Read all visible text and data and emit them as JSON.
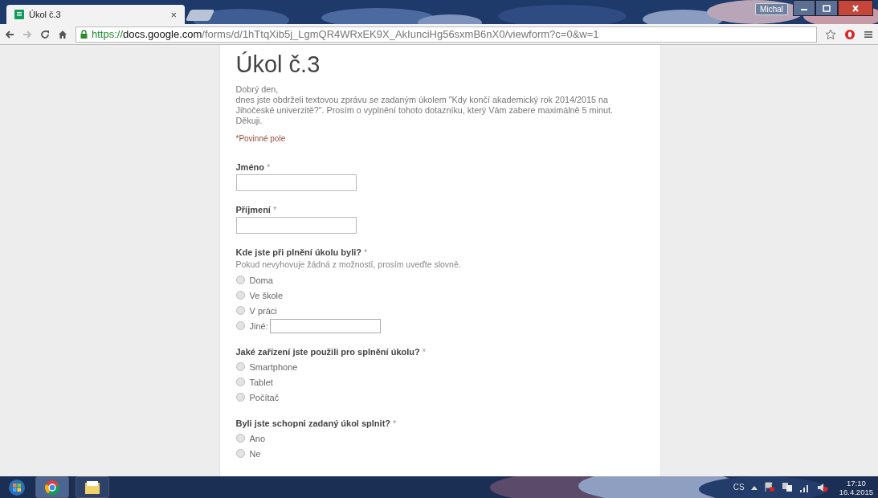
{
  "browser": {
    "tab": {
      "title": "Úkol č.3",
      "close": "×",
      "selected": true
    },
    "user": "Michal",
    "url": {
      "scheme": "https://",
      "host": "docs.google.com",
      "path": "/forms/d/1hTtqXib5j_LgmQR4WRxEK9X_AkIunciHg56sxmB6nX0/viewform?c=0&w=1"
    }
  },
  "form": {
    "title": "Úkol č.3",
    "intro": [
      "Dobrý den,",
      "dnes jste obdrželi textovou zprávu se zadaným úkolem \"Kdy končí akademický rok 2014/2015 na Jihočeské univerzitě?\". Prosím o vyplnění tohoto dotazníku, který Vám zabere maximálně 5 minut.",
      "Děkuji."
    ],
    "required_note": "*Povinné pole",
    "questions": [
      {
        "kind": "text",
        "label": "Jméno",
        "required_mark": "*"
      },
      {
        "kind": "text",
        "label": "Příjmení",
        "required_mark": "*"
      },
      {
        "kind": "radio",
        "label": "Kde jste při plnění úkolu byli?",
        "required_mark": "*",
        "help": "Pokud nevyhovuje žádná z možností, prosím uveďte slovně.",
        "options": [
          {
            "kind": "plain",
            "label": "Doma",
            "checked": false
          },
          {
            "kind": "plain",
            "label": "Ve škole",
            "checked": false
          },
          {
            "kind": "plain",
            "label": "V práci",
            "checked": false
          },
          {
            "kind": "other",
            "label": "Jiné:",
            "checked": false
          }
        ]
      },
      {
        "kind": "radio",
        "label": "Jaké zařízení jste použili pro splnění úkolu?",
        "required_mark": "*",
        "options": [
          {
            "kind": "plain",
            "label": "Smartphone",
            "checked": false
          },
          {
            "kind": "plain",
            "label": "Tablet",
            "checked": false
          },
          {
            "kind": "plain",
            "label": "Počítač",
            "checked": false
          }
        ]
      },
      {
        "kind": "radio",
        "label": "Byli jste schopni zadaný úkol splnit?",
        "required_mark": "*",
        "options": [
          {
            "kind": "plain",
            "label": "Ano",
            "checked": false
          },
          {
            "kind": "plain",
            "label": "Ne",
            "checked": false
          }
        ]
      }
    ]
  },
  "taskbar": {
    "language": "CS",
    "time": "17:10",
    "date": "16.4.2015"
  }
}
